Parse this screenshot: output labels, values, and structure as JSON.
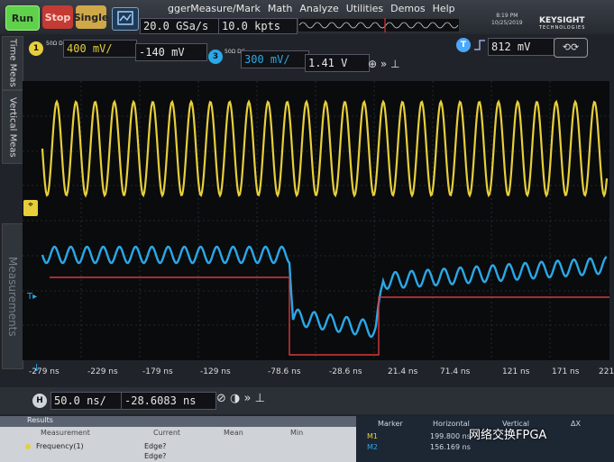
{
  "toolbar": {
    "run_label": "Run",
    "stop_label": "Stop",
    "single_label": "Single",
    "sample_rate": "20.0 GSa/s",
    "memory_depth": "10.0 kpts"
  },
  "menu": [
    "ggerMeasure/Mark",
    "Math",
    "Analyze",
    "Utilities",
    "Demos",
    "Help"
  ],
  "clock": {
    "time": "8:19 PM",
    "date": "10/25/2019"
  },
  "brand": {
    "name": "KEYSIGHT",
    "sub": "TECHNOLOGIES"
  },
  "channel1": {
    "number": "1",
    "coupling": "50Ω DC",
    "scale": "400 mV/",
    "offset": "-140 mV",
    "color": "#e7cf3a"
  },
  "channel3": {
    "number": "3",
    "coupling": "50Ω DC",
    "scale": "300 mV/",
    "offset": "1.41 V",
    "color": "#2aa8e8"
  },
  "trigger": {
    "label": "T",
    "level": "812 mV"
  },
  "side_tabs": [
    "Time Meas",
    "Vertical Meas",
    "Measurements"
  ],
  "time_axis": [
    "-279 ns",
    "-229 ns",
    "-179 ns",
    "-129 ns",
    "-78.6 ns",
    "-28.6 ns",
    "21.4 ns",
    "71.4 ns",
    "121 ns",
    "171 ns",
    "221"
  ],
  "timebase": {
    "label": "H",
    "scale": "50.0 ns/",
    "position": "-28.6083 ns"
  },
  "results": {
    "title": "Results",
    "columns": [
      "Measurement",
      "Current",
      "Mean",
      "Min"
    ],
    "rows": [
      {
        "name": "Frequency(1)",
        "current": "Edge?",
        "mean": "",
        "min": ""
      },
      {
        "name": "",
        "current": "Edge?",
        "mean": "",
        "min": ""
      }
    ]
  },
  "markers": {
    "columns": [
      "Marker",
      "Horizontal",
      "Vertical",
      "ΔX"
    ],
    "rows": [
      {
        "marker": "M1",
        "horizontal": "199.800 ns",
        "vertical": "",
        "dx": ""
      },
      {
        "marker": "M2",
        "horizontal": "156.169 ns",
        "vertical": "",
        "dx": ""
      }
    ]
  },
  "watermark": "网络交换FPGA"
}
